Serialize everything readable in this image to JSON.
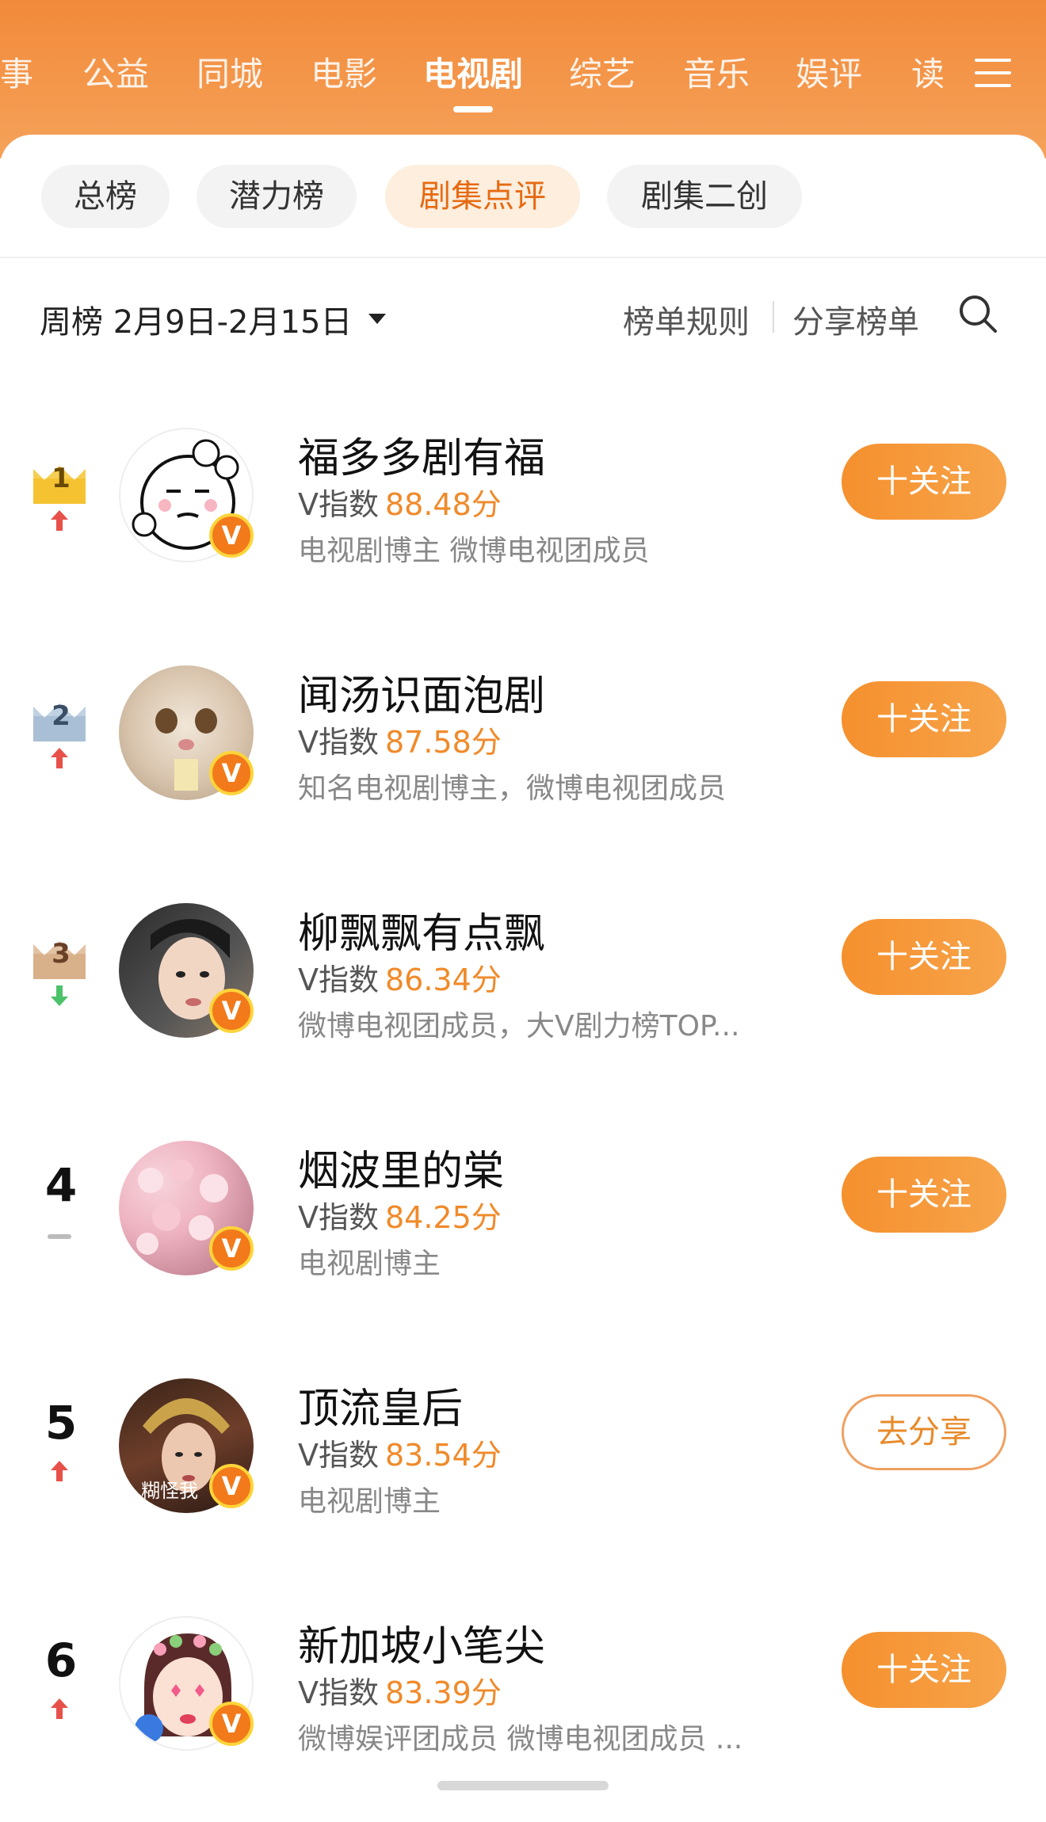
{
  "category_tabs": [
    {
      "label": "事"
    },
    {
      "label": "公益"
    },
    {
      "label": "同城"
    },
    {
      "label": "电影"
    },
    {
      "label": "电视剧",
      "active": true
    },
    {
      "label": "综艺"
    },
    {
      "label": "音乐"
    },
    {
      "label": "娱评"
    },
    {
      "label": "读"
    }
  ],
  "menu_icon": "hamburger-menu-icon",
  "sub_tabs": [
    {
      "label": "总榜"
    },
    {
      "label": "潜力榜"
    },
    {
      "label": "剧集点评",
      "active": true
    },
    {
      "label": "剧集二创"
    }
  ],
  "period": {
    "label": "周榜 2月9日-2月15日"
  },
  "actions": {
    "rules": "榜单规则",
    "share": "分享榜单",
    "search_icon": "search-icon"
  },
  "colors": {
    "accent": "#f08a2a",
    "trend_up": "#e8514a",
    "trend_down": "#4cc26a",
    "trend_flat": "#bbbbbb"
  },
  "rankings": [
    {
      "rank": "1",
      "trend": "up",
      "name": "福多多剧有福",
      "score_label": "V指数",
      "score": "88.48分",
      "desc": "电视剧博主 微博电视团成员",
      "button": "十关注",
      "badge": "V"
    },
    {
      "rank": "2",
      "trend": "up",
      "name": "闻汤识面泡剧",
      "score_label": "V指数",
      "score": "87.58分",
      "desc": "知名电视剧博主，微博电视团成员",
      "button": "十关注",
      "badge": "V"
    },
    {
      "rank": "3",
      "trend": "down",
      "name": "柳飘飘有点飘",
      "score_label": "V指数",
      "score": "86.34分",
      "desc": "微博电视团成员，大V剧力榜TOP...",
      "button": "十关注",
      "badge": "V"
    },
    {
      "rank": "4",
      "trend": "flat",
      "name": "烟波里的棠",
      "score_label": "V指数",
      "score": "84.25分",
      "desc": "电视剧博主",
      "button": "十关注",
      "badge": "V"
    },
    {
      "rank": "5",
      "trend": "up",
      "name": "顶流皇后",
      "score_label": "V指数",
      "score": "83.54分",
      "desc": "电视剧博主",
      "button": "去分享",
      "badge": "V",
      "avatar_caption": "糊怪我"
    },
    {
      "rank": "6",
      "trend": "up",
      "name": "新加坡小笔尖",
      "score_label": "V指数",
      "score": "83.39分",
      "desc": "微博娱评团成员 微博电视团成员 ...",
      "button": "十关注",
      "badge": "V"
    }
  ]
}
